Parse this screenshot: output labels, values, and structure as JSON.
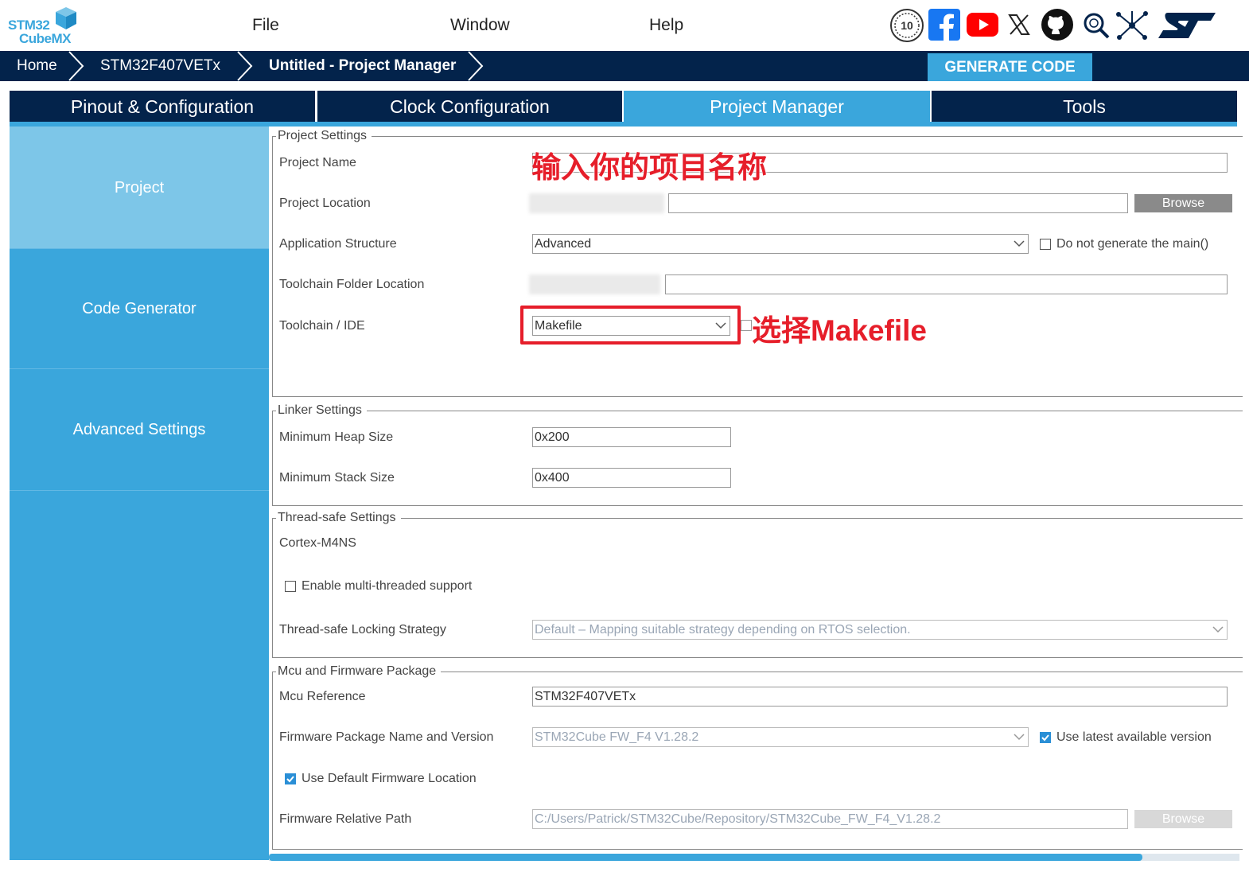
{
  "app": {
    "logo_line1": "STM32",
    "logo_line2": "CubeMX"
  },
  "menu": {
    "file": "File",
    "window": "Window",
    "help": "Help"
  },
  "toolbar_icons": [
    "anniversary-10-icon",
    "facebook-icon",
    "youtube-icon",
    "x-icon",
    "github-icon",
    "community-search-icon",
    "network-icon",
    "st-logo-icon"
  ],
  "breadcrumb": {
    "home": "Home",
    "device": "STM32F407VETx",
    "current": "Untitled - Project Manager"
  },
  "generate_code": "GENERATE CODE",
  "tabs": [
    {
      "label": "Pinout & Configuration",
      "active": false
    },
    {
      "label": "Clock Configuration",
      "active": false
    },
    {
      "label": "Project Manager",
      "active": true
    },
    {
      "label": "Tools",
      "active": false
    }
  ],
  "sidebar": {
    "items": [
      {
        "label": "Project",
        "active": true
      },
      {
        "label": "Code Generator",
        "active": false
      },
      {
        "label": "Advanced Settings",
        "active": false
      }
    ]
  },
  "project_settings": {
    "title": "Project Settings",
    "project_name_label": "Project Name",
    "project_name_value": "",
    "project_location_label": "Project Location",
    "project_location_value": "",
    "browse_label": "Browse",
    "app_structure_label": "Application Structure",
    "app_structure_value": "Advanced",
    "do_not_generate_main_label": "Do not generate the main()",
    "do_not_generate_main_checked": false,
    "toolchain_folder_label": "Toolchain Folder Location",
    "toolchain_folder_value": "",
    "toolchain_ide_label": "Toolchain / IDE",
    "toolchain_ide_value": "Makefile"
  },
  "linker_settings": {
    "title": "Linker Settings",
    "heap_label": "Minimum Heap Size",
    "heap_value": "0x200",
    "stack_label": "Minimum Stack Size",
    "stack_value": "0x400"
  },
  "thread_safe": {
    "title": "Thread-safe Settings",
    "core": "Cortex-M4NS",
    "multi_thread_label": "Enable multi-threaded support",
    "multi_thread_checked": false,
    "strategy_label": "Thread-safe Locking Strategy",
    "strategy_value": "Default – Mapping suitable strategy depending on RTOS selection."
  },
  "mcu_firmware": {
    "title": "Mcu and Firmware Package",
    "mcu_ref_label": "Mcu Reference",
    "mcu_ref_value": "STM32F407VETx",
    "fw_label": "Firmware Package Name and Version",
    "fw_value": "STM32Cube FW_F4 V1.28.2",
    "use_latest_label": "Use latest available version",
    "use_latest_checked": true,
    "use_default_label": "Use Default Firmware Location",
    "use_default_checked": true,
    "rel_path_label": "Firmware Relative Path",
    "rel_path_value": "C:/Users/Patrick/STM32Cube/Repository/STM32Cube_FW_F4_V1.28.2",
    "browse_label": "Browse"
  },
  "annotations": {
    "name_hint": "输入你的项目名称",
    "makefile_hint": "选择Makefile"
  },
  "colors": {
    "navy": "#03234b",
    "accent": "#3aa6dc",
    "sidebar_active": "#7dc6e8",
    "annotation": "#e61e2a"
  }
}
